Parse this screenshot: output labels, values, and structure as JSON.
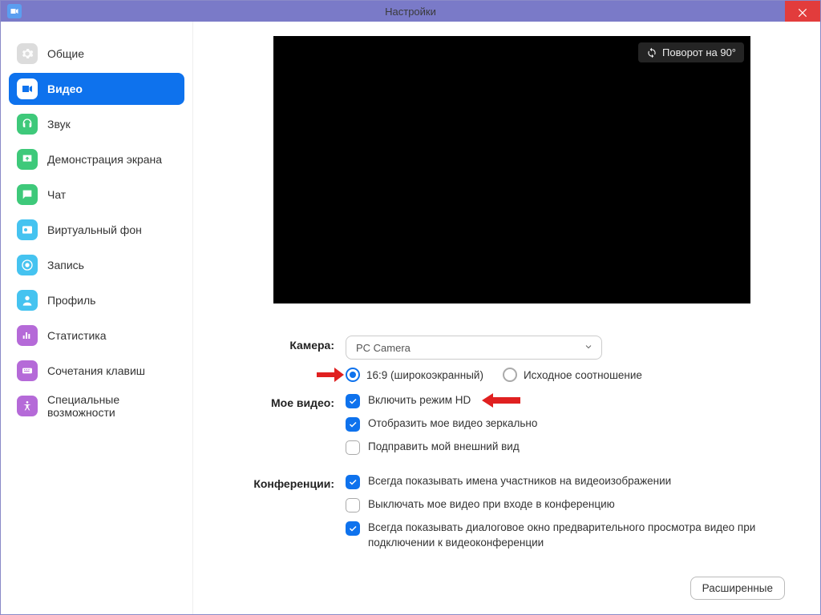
{
  "window": {
    "title": "Настройки"
  },
  "sidebar": {
    "items": [
      {
        "label": "Общие",
        "icon": "gear",
        "bg": "#dcdcdc",
        "fg": "#fff"
      },
      {
        "label": "Видео",
        "icon": "camera",
        "bg": "#ffffff",
        "fg": "#0e72ed",
        "active": true
      },
      {
        "label": "Звук",
        "icon": "headset",
        "bg": "#3ec97a",
        "fg": "#fff"
      },
      {
        "label": "Демонстрация экрана",
        "icon": "share",
        "bg": "#3ec97a",
        "fg": "#fff"
      },
      {
        "label": "Чат",
        "icon": "chat",
        "bg": "#3ec97a",
        "fg": "#fff"
      },
      {
        "label": "Виртуальный фон",
        "icon": "virtual",
        "bg": "#45c3f0",
        "fg": "#fff"
      },
      {
        "label": "Запись",
        "icon": "record",
        "bg": "#45c3f0",
        "fg": "#fff"
      },
      {
        "label": "Профиль",
        "icon": "profile",
        "bg": "#45c3f0",
        "fg": "#fff"
      },
      {
        "label": "Статистика",
        "icon": "stats",
        "bg": "#b56ad8",
        "fg": "#fff"
      },
      {
        "label": "Сочетания клавиш",
        "icon": "keyboard",
        "bg": "#b56ad8",
        "fg": "#fff"
      },
      {
        "label": "Специальные возможности",
        "icon": "access",
        "bg": "#b56ad8",
        "fg": "#fff"
      }
    ]
  },
  "preview": {
    "rotate_label": "Поворот на 90°"
  },
  "camera": {
    "label": "Камера:",
    "selected": "PC Camera",
    "ratio": {
      "wide": "16:9 (широкоэкранный)",
      "orig": "Исходное соотношение",
      "selected": "wide"
    }
  },
  "my_video": {
    "label": "Мое видео:",
    "options": [
      {
        "label": "Включить режим HD",
        "checked": true
      },
      {
        "label": "Отобразить мое видео зеркально",
        "checked": true
      },
      {
        "label": "Подправить мой внешний вид",
        "checked": false
      }
    ]
  },
  "meetings": {
    "label": "Конференции:",
    "options": [
      {
        "label": "Всегда показывать имена участников на видеоизображении",
        "checked": true
      },
      {
        "label": "Выключать мое видео при входе в конференцию",
        "checked": false
      },
      {
        "label": "Всегда показывать диалоговое окно предварительного просмотра видео при подключении к видеоконференции",
        "checked": true
      }
    ]
  },
  "advanced_button": "Расширенные"
}
